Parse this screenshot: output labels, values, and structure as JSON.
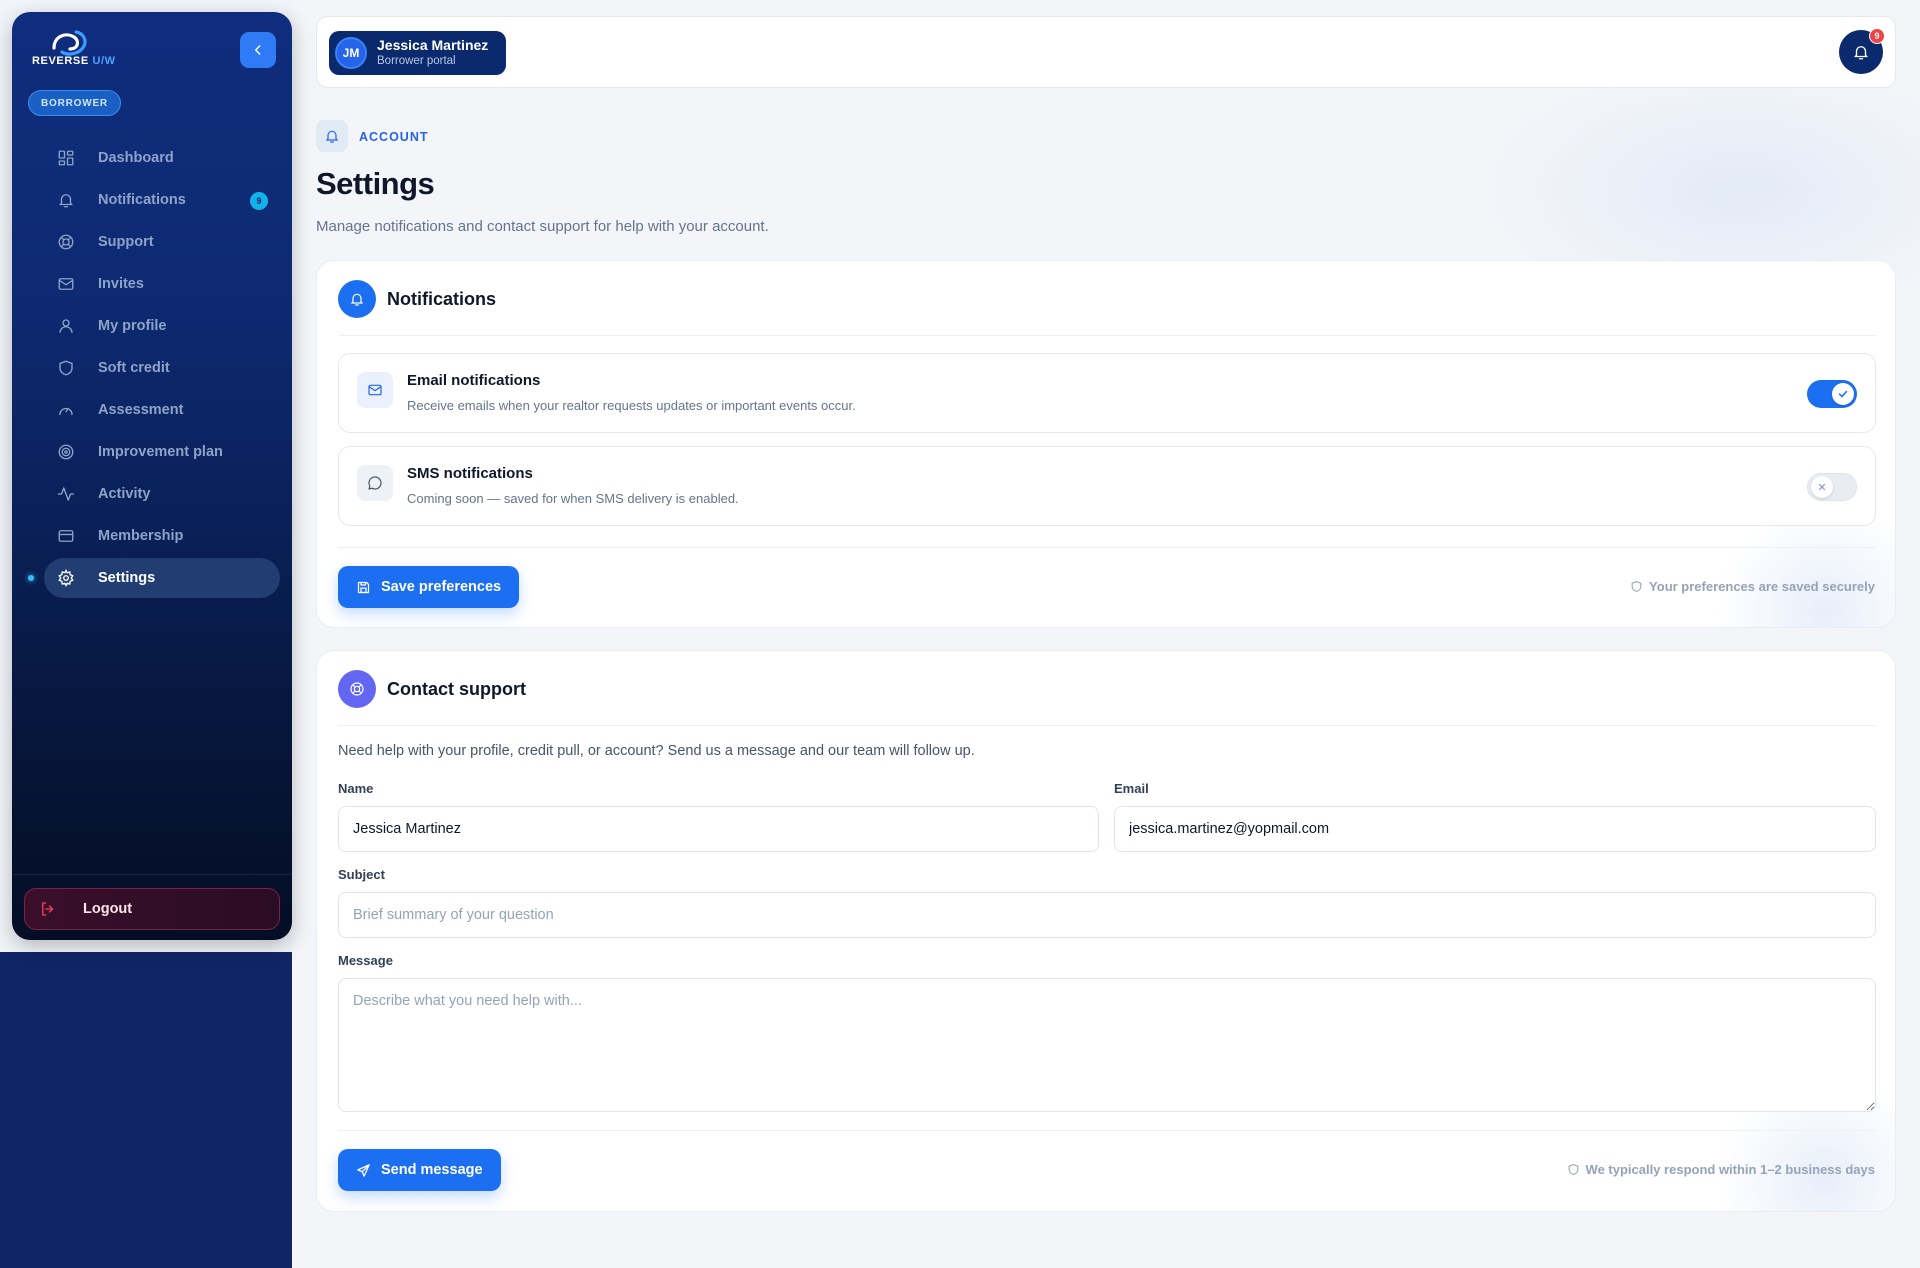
{
  "app": {
    "logo_word": "REVERSE",
    "logo_accent": "U/W",
    "role_badge": "BORROWER"
  },
  "sidebar": {
    "items": [
      {
        "label": "Dashboard",
        "icon": "grid-icon"
      },
      {
        "label": "Notifications",
        "icon": "bell-icon",
        "badge": "9"
      },
      {
        "label": "Support",
        "icon": "lifebuoy-icon"
      },
      {
        "label": "Invites",
        "icon": "mail-icon"
      },
      {
        "label": "My profile",
        "icon": "user-icon"
      },
      {
        "label": "Soft credit",
        "icon": "shield-icon"
      },
      {
        "label": "Assessment",
        "icon": "gauge-icon"
      },
      {
        "label": "Improvement plan",
        "icon": "target-icon"
      },
      {
        "label": "Activity",
        "icon": "activity-icon"
      },
      {
        "label": "Membership",
        "icon": "card-icon"
      },
      {
        "label": "Settings",
        "icon": "gear-icon",
        "active": true
      }
    ],
    "logout_label": "Logout"
  },
  "topbar": {
    "avatar_initials": "JM",
    "user_name": "Jessica Martinez",
    "user_subtitle": "Borrower portal",
    "notification_count": "9"
  },
  "header": {
    "eyebrow": "ACCOUNT",
    "title": "Settings",
    "subtitle": "Manage notifications and contact support for help with your account."
  },
  "notifications_card": {
    "title": "Notifications",
    "email": {
      "title": "Email notifications",
      "description": "Receive emails when your realtor requests updates or important events occur.",
      "enabled": true
    },
    "sms": {
      "title": "SMS notifications",
      "description": "Coming soon — saved for when SMS delivery is enabled.",
      "enabled": false
    },
    "save_label": "Save preferences",
    "footnote": "Your preferences are saved securely"
  },
  "support_card": {
    "title": "Contact support",
    "help_text": "Need help with your profile, credit pull, or account? Send us a message and our team will follow up.",
    "name_label": "Name",
    "name_value": "Jessica Martinez",
    "email_label": "Email",
    "email_value": "jessica.martinez@yopmail.com",
    "subject_label": "Subject",
    "subject_placeholder": "Brief summary of your question",
    "message_label": "Message",
    "message_placeholder": "Describe what you need help with...",
    "send_label": "Send message",
    "footnote": "We typically respond within 1–2 business days"
  },
  "colors": {
    "accent": "#1d6ff2",
    "sidebar_top": "#0f2d7d",
    "sidebar_bottom": "#040d24",
    "badge_cyan": "#12b2ea",
    "alert_red": "#ef4444",
    "support_purple": "#6366f1"
  }
}
